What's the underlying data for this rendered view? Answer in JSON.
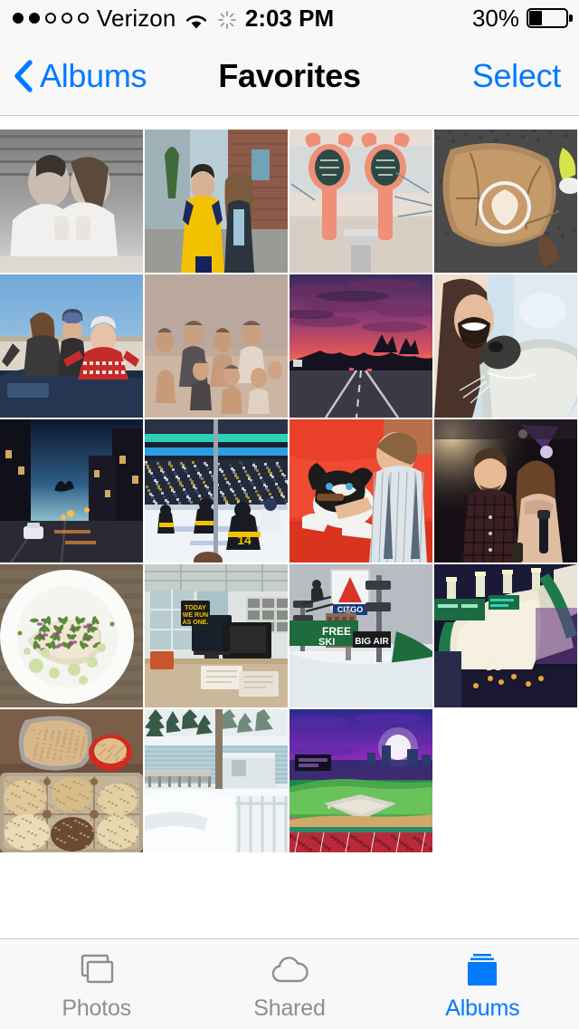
{
  "status_bar": {
    "carrier": "Verizon",
    "signal_dots_total": 5,
    "signal_dots_filled": 2,
    "wifi_icon": "wifi-icon",
    "activity_icon": "activity-spinner-icon",
    "time": "2:03 PM",
    "battery_percent": "30%",
    "battery_level": 30
  },
  "nav_bar": {
    "back_icon": "chevron-left-icon",
    "back_label": "Albums",
    "title": "Favorites",
    "select_label": "Select"
  },
  "colors": {
    "accent": "#007aff",
    "inactive": "#8e8e93",
    "bar_background": "#f8f8f8",
    "separator": "#c8c7cc",
    "page_background": "#ffffff"
  },
  "grid": {
    "columns": 4,
    "rows": 5,
    "photo_count": 19,
    "photos": [
      {
        "id": 1,
        "row": 1,
        "col": 1,
        "description": "Black and white photo of a couple toasting drinks"
      },
      {
        "id": 2,
        "row": 1,
        "col": 2,
        "description": "Couple on a brick city street, man in yellow hockey jersey"
      },
      {
        "id": 3,
        "row": 1,
        "col": 3,
        "description": "Coffee shop tap handles with chalkboard signs"
      },
      {
        "id": 4,
        "row": 1,
        "col": 4,
        "description": "Latte with foam art on a wooden stump, shoes below"
      },
      {
        "id": 5,
        "row": 2,
        "col": 1,
        "description": "Friends on top of a car wearing holiday sweaters"
      },
      {
        "id": 6,
        "row": 2,
        "col": 2,
        "description": "Vintage group photo of kids on a sandy beach"
      },
      {
        "id": 7,
        "row": 2,
        "col": 3,
        "description": "Pink and purple sunset over a highway"
      },
      {
        "id": 8,
        "row": 2,
        "col": 4,
        "description": "Selfie of a smiling woman with a husky dog"
      },
      {
        "id": 9,
        "row": 3,
        "col": 1,
        "description": "City street at dusk with parked car and blue sky"
      },
      {
        "id": 10,
        "row": 3,
        "col": 2,
        "description": "Bruins hockey game from the stands in an arena"
      },
      {
        "id": 11,
        "row": 3,
        "col": 3,
        "description": "Boy petting a husky puppy on a red couch"
      },
      {
        "id": 12,
        "row": 3,
        "col": 4,
        "description": "Couple smiling at a dark nightclub with stage lights"
      },
      {
        "id": 13,
        "row": 4,
        "col": 1,
        "description": "Plated dish with herbs and green sauce on white plate"
      },
      {
        "id": 14,
        "row": 4,
        "col": 2,
        "description": "Office desk with monitor and TODAY WE RUN AS ONE sign"
      },
      {
        "id": 15,
        "row": 4,
        "col": 3,
        "description": "Skier jumping past the CITGO sign at Big Air Fenway"
      },
      {
        "id": 16,
        "row": 4,
        "col": 4,
        "description": "Big Air ski ramp lit up at night in Fenway Park"
      },
      {
        "id": 17,
        "row": 5,
        "col": 1,
        "description": "Muffin tin with coconut macaroons and glass bowl"
      },
      {
        "id": 18,
        "row": 5,
        "col": 2,
        "description": "Snow covered dock and lake with evergreen trees"
      },
      {
        "id": 19,
        "row": 5,
        "col": 3,
        "description": "Fenway Park baseball field under a purple sunset"
      }
    ]
  },
  "tab_bar": {
    "tabs": [
      {
        "label": "Photos",
        "icon": "photos-stack-icon",
        "active": false
      },
      {
        "label": "Shared",
        "icon": "cloud-icon",
        "active": false
      },
      {
        "label": "Albums",
        "icon": "albums-book-icon",
        "active": true
      }
    ]
  }
}
